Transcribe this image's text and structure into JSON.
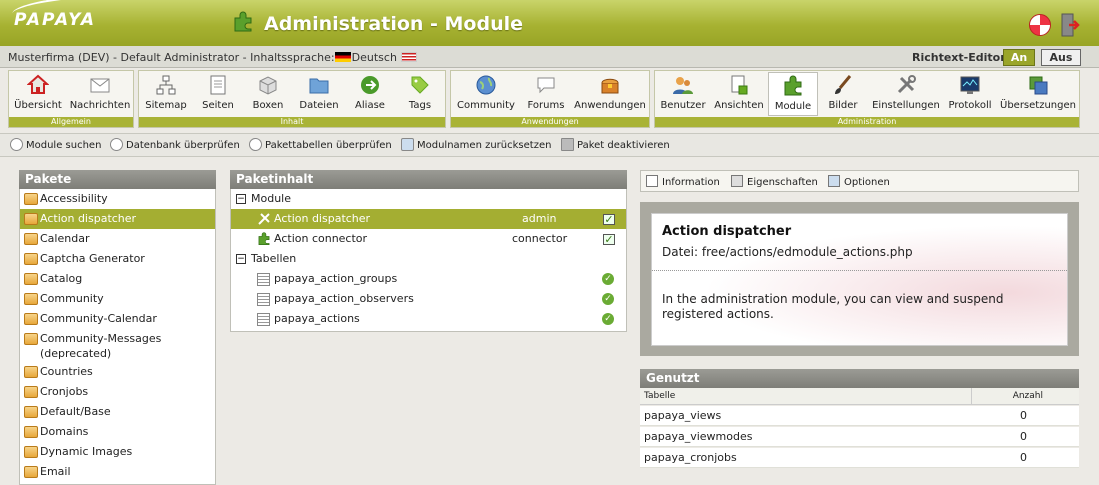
{
  "header": {
    "logo": "PAPAYA",
    "title": "Administration - Module"
  },
  "infobar": {
    "user_text": "Musterfirma (DEV) - Default Administrator - Inhaltssprache:",
    "language": "Deutsch",
    "editor_label": "Richtext-Editor",
    "btn_on": "An",
    "btn_off": "Aus"
  },
  "toolbar": {
    "groups": [
      "Allgemein",
      "Inhalt",
      "Anwendungen",
      "Administration"
    ],
    "items": {
      "overview": "Übersicht",
      "messages": "Nachrichten",
      "sitemap": "Sitemap",
      "pages": "Seiten",
      "boxes": "Boxen",
      "files": "Dateien",
      "aliases": "Aliase",
      "tags": "Tags",
      "community": "Community",
      "forums": "Forums",
      "applications": "Anwendungen",
      "users": "Benutzer",
      "views": "Ansichten",
      "modules": "Module",
      "images": "Bilder",
      "settings": "Einstellungen",
      "protocol": "Protokoll",
      "translations": "Übersetzungen"
    }
  },
  "actions": {
    "search_modules": "Module suchen",
    "check_db": "Datenbank überprüfen",
    "check_tables": "Pakettabellen überprüfen",
    "reset_names": "Modulnamen zurücksetzen",
    "deactivate": "Paket deaktivieren"
  },
  "packages": {
    "title": "Pakete",
    "items": [
      "Accessibility",
      "Action dispatcher",
      "Calendar",
      "Captcha Generator",
      "Catalog",
      "Community",
      "Community-Calendar",
      "Community-Messages (deprecated)",
      "Countries",
      "Cronjobs",
      "Default/Base",
      "Domains",
      "Dynamic Images",
      "Email"
    ],
    "selected": "Action dispatcher"
  },
  "content": {
    "title": "Paketinhalt",
    "modules_label": "Module",
    "modules": [
      {
        "name": "Action dispatcher",
        "type": "admin"
      },
      {
        "name": "Action connector",
        "type": "connector"
      }
    ],
    "tables_label": "Tabellen",
    "tables": [
      "papaya_action_groups",
      "papaya_action_observers",
      "papaya_actions"
    ]
  },
  "info": {
    "tabs": [
      "Information",
      "Eigenschaften",
      "Optionen"
    ],
    "title": "Action dispatcher",
    "file": "Datei: free/actions/edmodule_actions.php",
    "description": "In the administration module, you can view and suspend registered actions."
  },
  "usage": {
    "title": "Genutzt",
    "col_table": "Tabelle",
    "col_count": "Anzahl",
    "rows": [
      {
        "table": "papaya_views",
        "count": "0"
      },
      {
        "table": "papaya_viewmodes",
        "count": "0"
      },
      {
        "table": "papaya_cronjobs",
        "count": "0"
      }
    ]
  }
}
